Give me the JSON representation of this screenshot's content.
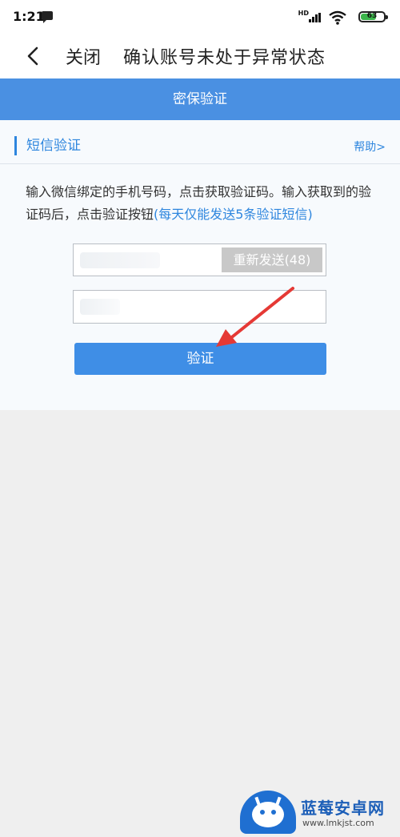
{
  "status_bar": {
    "time": "1:21",
    "battery": "63",
    "network_label": "HD"
  },
  "nav": {
    "close_label": "关闭",
    "title": "确认账号未处于异常状态"
  },
  "banner": {
    "title": "密保验证"
  },
  "section": {
    "title": "短信验证",
    "help_label": "帮助>"
  },
  "description": {
    "text": "输入微信绑定的手机号码，点击获取验证码。输入获取到的验证码后，点击验证按钮",
    "highlight": "(每天仅能发送5条验证短信)"
  },
  "form": {
    "resend_label": "重新发送(48)",
    "verify_label": "验证"
  },
  "watermark": {
    "title": "蓝莓安卓网",
    "url": "www.lmkjst.com"
  },
  "colors": {
    "accent": "#4a90e2",
    "button": "#3f8ee6",
    "link": "#2e86de",
    "arrow": "#e53935"
  }
}
